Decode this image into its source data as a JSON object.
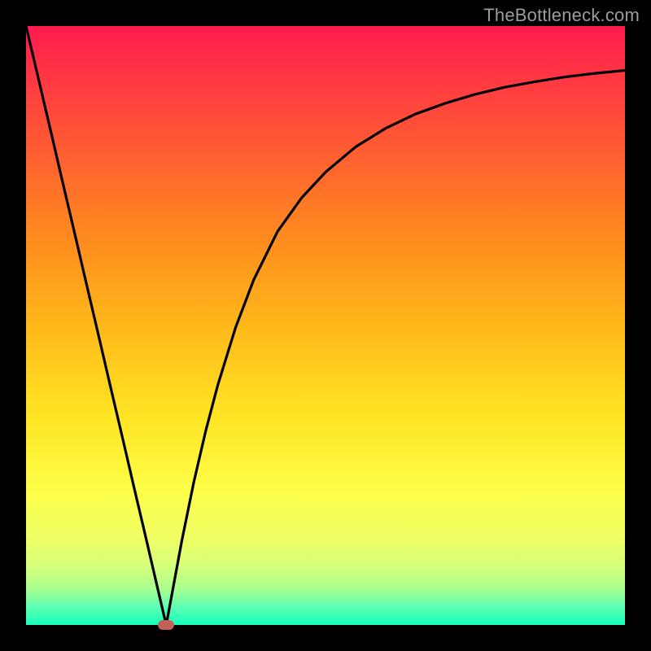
{
  "watermark": {
    "text": "TheBottleneck.com"
  },
  "colors": {
    "frame": "#000000",
    "marker": "#c1625a",
    "curve": "#000000",
    "gradient_top": "#ff1a4d",
    "gradient_bottom": "#17ffb9"
  },
  "chart_data": {
    "type": "line",
    "title": "",
    "xlabel": "",
    "ylabel": "",
    "xlim": [
      0,
      100
    ],
    "ylim": [
      0,
      100
    ],
    "grid": false,
    "legend": false,
    "x": [
      0,
      2,
      4,
      6,
      8,
      10,
      12,
      14,
      16,
      18,
      20,
      22,
      23.4,
      24,
      26,
      28,
      30,
      32,
      35,
      38,
      42,
      46,
      50,
      55,
      60,
      65,
      70,
      75,
      80,
      85,
      90,
      95,
      100
    ],
    "y": [
      100,
      91.5,
      83,
      74.4,
      65.9,
      57.3,
      48.8,
      40.2,
      31.7,
      23.1,
      14.6,
      6,
      0,
      3.2,
      14,
      23.8,
      32.4,
      40,
      49.7,
      57.6,
      65.7,
      71.3,
      75.6,
      79.8,
      82.9,
      85.3,
      87.1,
      88.6,
      89.8,
      90.7,
      91.5,
      92.1,
      92.6
    ],
    "annotations": [
      {
        "type": "marker",
        "x": 23.4,
        "y": 0,
        "shape": "rounded-rect"
      }
    ]
  }
}
